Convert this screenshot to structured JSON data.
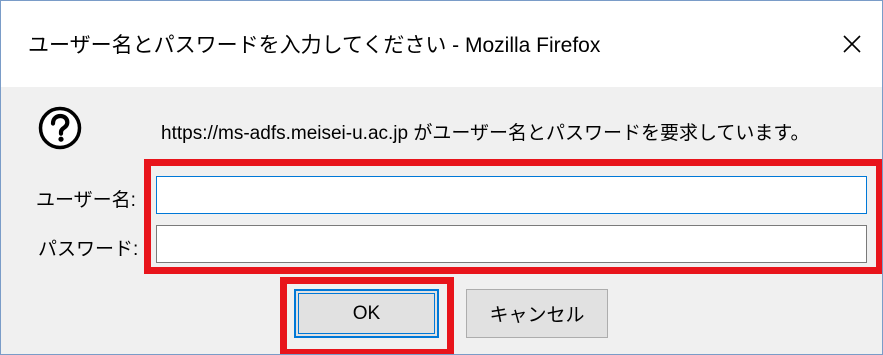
{
  "window": {
    "title": "ユーザー名とパスワードを入力してください - Mozilla Firefox",
    "close_icon": "close-icon"
  },
  "prompt": {
    "icon": "question-mark-icon",
    "message": "https://ms-adfs.meisei-u.ac.jp がユーザー名とパスワードを要求しています。"
  },
  "form": {
    "username_label": "ユーザー名:",
    "username_value": "",
    "password_label": "パスワード:",
    "password_value": ""
  },
  "buttons": {
    "ok_label": "OK",
    "cancel_label": "キャンセル"
  },
  "colors": {
    "highlight": "#e8141b",
    "focus_accent": "#0078d7",
    "dialog_bg": "#f0f0f0",
    "titlebar_bg": "#ffffff"
  }
}
